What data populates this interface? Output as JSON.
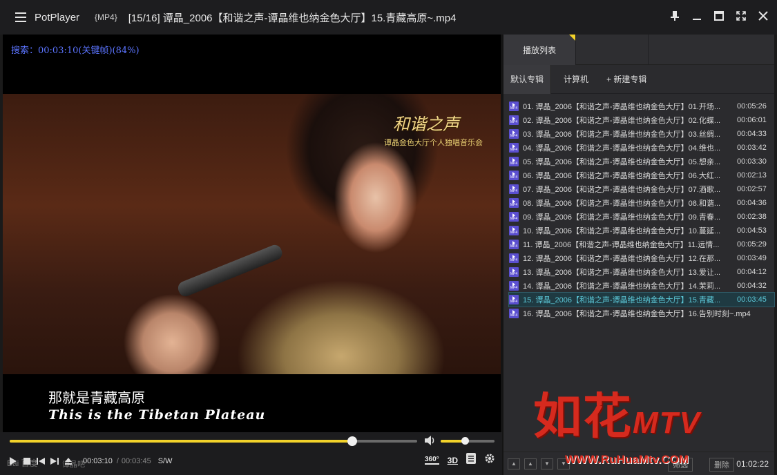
{
  "titlebar": {
    "app_name": "PotPlayer",
    "file_type": "{MP4}",
    "file_title": "[15/16] 谭晶_2006【和谐之声-谭晶维也纳金色大厅】15.青藏高原~.mp4"
  },
  "video": {
    "osd": "搜索：00:03:10(关键帧)(84%)",
    "subtitle_cn": "那就是青藏高原",
    "subtitle_en": "This is the Tibetan Plateau",
    "logo_text": "和谐之声",
    "logo_sub": "谭晶金色大厅个人独唱音乐会"
  },
  "controls": {
    "progress_fraction": 0.84,
    "volume_fraction": 0.45,
    "time_current": "00:03:10",
    "time_separator": "/",
    "time_total": "00:03:45",
    "sw_label": "S/W",
    "badge_360": "360°",
    "badge_3d": "3D",
    "watermark_baidu": "Bai 百度",
    "watermark_bar": "谭晶吧"
  },
  "panel": {
    "tabs": [
      "播放列表"
    ],
    "album_tabs": [
      "默认专辑",
      "计算机",
      "+ 新建专辑"
    ],
    "items": [
      {
        "name": "01. 谭晶_2006【和谐之声-谭晶维也纳金色大厅】01.开场...",
        "duration": "00:05:26"
      },
      {
        "name": "02. 谭晶_2006【和谐之声-谭晶维也纳金色大厅】02.化蝶...",
        "duration": "00:06:01"
      },
      {
        "name": "03. 谭晶_2006【和谐之声-谭晶维也纳金色大厅】03.丝绸...",
        "duration": "00:04:33"
      },
      {
        "name": "04. 谭晶_2006【和谐之声-谭晶维也纳金色大厅】04.维也...",
        "duration": "00:03:42"
      },
      {
        "name": "05. 谭晶_2006【和谐之声-谭晶维也纳金色大厅】05.想亲...",
        "duration": "00:03:30"
      },
      {
        "name": "06. 谭晶_2006【和谐之声-谭晶维也纳金色大厅】06.大红...",
        "duration": "00:02:13"
      },
      {
        "name": "07. 谭晶_2006【和谐之声-谭晶维也纳金色大厅】07.酒歌...",
        "duration": "00:02:57"
      },
      {
        "name": "08. 谭晶_2006【和谐之声-谭晶维也纳金色大厅】08.和谐...",
        "duration": "00:04:36"
      },
      {
        "name": "09. 谭晶_2006【和谐之声-谭晶维也纳金色大厅】09.青春...",
        "duration": "00:02:38"
      },
      {
        "name": "10. 谭晶_2006【和谐之声-谭晶维也纳金色大厅】10.蔓延...",
        "duration": "00:04:53"
      },
      {
        "name": "11. 谭晶_2006【和谐之声-谭晶维也纳金色大厅】11.远情...",
        "duration": "00:05:29"
      },
      {
        "name": "12. 谭晶_2006【和谐之声-谭晶维也纳金色大厅】12.在那...",
        "duration": "00:03:49"
      },
      {
        "name": "13. 谭晶_2006【和谐之声-谭晶维也纳金色大厅】13.爱让...",
        "duration": "00:04:12"
      },
      {
        "name": "14. 谭晶_2006【和谐之声-谭晶维也纳金色大厅】14.茉莉...",
        "duration": "00:04:32"
      },
      {
        "name": "15. 谭晶_2006【和谐之声-谭晶维也纳金色大厅】15.青藏...",
        "duration": "00:03:45",
        "current": true
      },
      {
        "name": "16. 谭晶_2006【和谐之声-谭晶维也纳金色大厅】16.告别时刻~.mp4",
        "duration": ""
      }
    ],
    "footer_filter": "筛选",
    "footer_delete": "删除",
    "footer_time": "01:02:22"
  },
  "watermark": {
    "ruhua_text": "如花",
    "ruhua_mtv": "MTV",
    "ruhua_url": "WWW.RuHuaMtv.COM"
  },
  "colors": {
    "accent": "#f2d22a",
    "current_item": "#5cc8d8",
    "osd_text": "#5b74ff",
    "watermark_red": "#d62a1e"
  },
  "icons": [
    "menu-icon",
    "pin-icon",
    "minimize-icon",
    "maximize-icon",
    "fullscreen-icon",
    "close-icon",
    "volume-icon",
    "play-icon",
    "stop-icon",
    "prev-icon",
    "next-icon",
    "eject-icon",
    "playlist-icon",
    "settings-icon",
    "mp4-file-icon"
  ]
}
